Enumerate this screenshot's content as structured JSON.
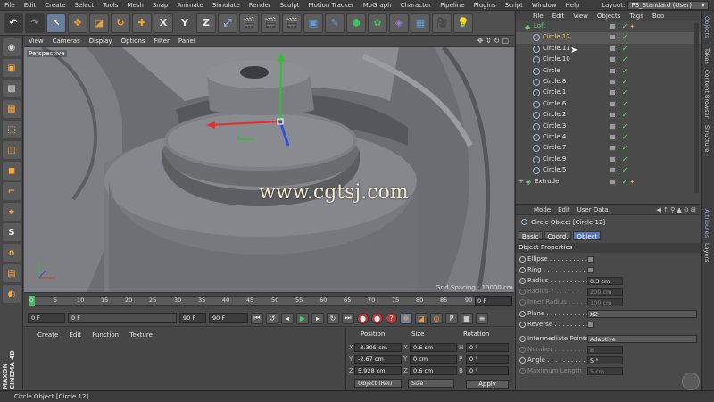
{
  "menubar": {
    "items": [
      "File",
      "Edit",
      "Create",
      "Select",
      "Tools",
      "Mesh",
      "Snap",
      "Animate",
      "Simulate",
      "Render",
      "Sculpt",
      "Motion Tracker",
      "MoGraph",
      "Character",
      "Pipeline",
      "Plugins",
      "Script",
      "Window",
      "Help"
    ],
    "layout_label": "Layout:",
    "layout_value": "PS_Standard (User)"
  },
  "toolbar": {
    "axis_labels": [
      "X",
      "Y",
      "Z"
    ]
  },
  "viewport": {
    "menu": [
      "View",
      "Cameras",
      "Display",
      "Options",
      "Filter",
      "Panel"
    ],
    "label": "Perspective",
    "grid_spacing": "Grid Spacing : 10000 cm",
    "watermark": "www.cgtsj.com"
  },
  "timeline": {
    "ticks": [
      "0",
      "5",
      "10",
      "15",
      "20",
      "25",
      "30",
      "35",
      "40",
      "45",
      "50",
      "55",
      "60",
      "65",
      "70",
      "75",
      "80",
      "85",
      "90"
    ],
    "current_frame": "0 F"
  },
  "transport": {
    "start": "0 F",
    "field2": "0 F",
    "end": "90 F",
    "end2": "90 F"
  },
  "material_manager": {
    "menu": [
      "Create",
      "Edit",
      "Function",
      "Texture"
    ]
  },
  "coord_manager": {
    "headers": [
      "Position",
      "Size",
      "Rotation"
    ],
    "rows": [
      {
        "axis": "X",
        "pos": "-3.395 cm",
        "size_axis": "X",
        "size": "0.6 cm",
        "rot_axis": "H",
        "rot": "0 °"
      },
      {
        "axis": "Y",
        "pos": "-2.67 cm",
        "size_axis": "Y",
        "size": "0 cm",
        "rot_axis": "P",
        "rot": "0 °"
      },
      {
        "axis": "Z",
        "pos": "5.928 cm",
        "size_axis": "Z",
        "size": "0.6 cm",
        "rot_axis": "B",
        "rot": "0 °"
      }
    ],
    "mode_dropdown": "Object (Rel)",
    "size_dropdown": "Size",
    "apply": "Apply"
  },
  "object_manager": {
    "menu": [
      "File",
      "Edit",
      "View",
      "Objects",
      "Tags",
      "Boo"
    ],
    "items": [
      {
        "name": "Loft",
        "kind": "loft"
      },
      {
        "name": "Circle.12",
        "kind": "circle"
      },
      {
        "name": "Circle.11",
        "kind": "circle"
      },
      {
        "name": "Circle.10",
        "kind": "circle"
      },
      {
        "name": "Circle",
        "kind": "circle"
      },
      {
        "name": "Circle.8",
        "kind": "circle"
      },
      {
        "name": "Circle.1",
        "kind": "circle"
      },
      {
        "name": "Circle.6",
        "kind": "circle"
      },
      {
        "name": "Circle.2",
        "kind": "circle"
      },
      {
        "name": "Circle.3",
        "kind": "circle"
      },
      {
        "name": "Circle.4",
        "kind": "circle"
      },
      {
        "name": "Circle.7",
        "kind": "circle"
      },
      {
        "name": "Circle.9",
        "kind": "circle"
      },
      {
        "name": "Circle.5",
        "kind": "circle"
      },
      {
        "name": "Extrude",
        "kind": "extrude"
      }
    ]
  },
  "attributes": {
    "menu": [
      "Mode",
      "Edit",
      "User Data"
    ],
    "title": "Circle Object [Circle.12]",
    "tabs": [
      "Basic",
      "Coord.",
      "Object"
    ],
    "active_tab": "Object",
    "section": "Object Properties",
    "ellipse": "Ellipse . . . . . . . . . .",
    "ring": "Ring . . . . . . . . . . . .",
    "radius_label": "Radius . . . . . . . . . .",
    "radius": "0.3 cm",
    "radius_y_label": "Radius Y . . . . . . . .",
    "radius_y": "200 cm",
    "inner_radius_label": "Inner Radius . . . . .",
    "inner_radius": "100 cm",
    "plane_label": "Plane . . . . . . . . . . .",
    "plane": "XZ",
    "reverse_label": "Reverse . . . . . . . . .",
    "interp_label": "Intermediate Points",
    "interp": "Adaptive",
    "number_label": "Number . . . . . . . . .",
    "number": "8",
    "angle_label": "Angle . . . . . . . . . . .",
    "angle": "5 °",
    "maxlen_label": "Maximum Length . .",
    "maxlen": "5 cm"
  },
  "right_tabs": [
    "Objects",
    "Takes",
    "Content Browser",
    "Structure",
    "Attributes",
    "Layers"
  ],
  "status": "Circle Object [Circle.12]",
  "colors": {
    "accent": "#5b79b0",
    "loft_icon": "#6ed07a",
    "check": "#6ee06e",
    "axis_x": "#e03030",
    "axis_y": "#30c030",
    "axis_z": "#3050e0"
  }
}
